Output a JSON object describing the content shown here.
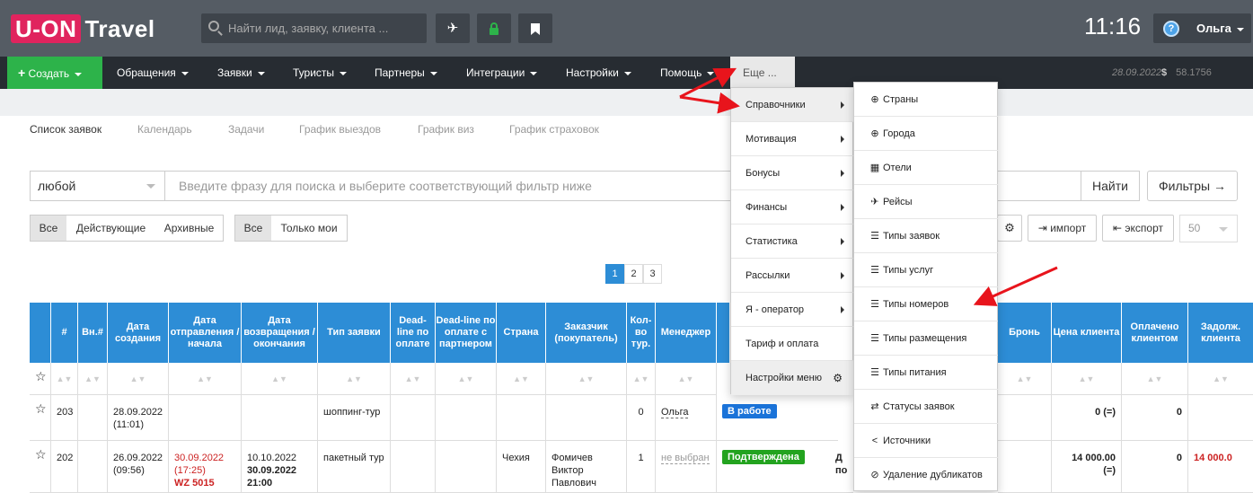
{
  "topbar": {
    "logo_box": "U-ON",
    "logo_text": "Travel",
    "search_placeholder": "Найти лид, заявку, клиента ...",
    "clock": "11:16",
    "user_name": "Ольга"
  },
  "nav": {
    "create": "Создать",
    "items": [
      "Обращения",
      "Заявки",
      "Туристы",
      "Партнеры",
      "Интеграции",
      "Настройки",
      "Помощь"
    ],
    "more": "Еще ...",
    "date": "28.09.2022",
    "currency_symbol": "$",
    "rate": "58.1756"
  },
  "tabs": [
    "Список заявок",
    "Календарь",
    "Задачи",
    "График выездов",
    "График виз",
    "График страховок"
  ],
  "search": {
    "scope": "любой",
    "placeholder": "Введите фразу для поиска и выберите соответствующий фильтр ниже",
    "find": "Найти",
    "filters": "Фильтры →"
  },
  "filters_row": {
    "group1": [
      "Все",
      "Действующие",
      "Архивные"
    ],
    "group2": [
      "Все",
      "Только мои"
    ]
  },
  "toolbar": {
    "import": "импорт",
    "export": "экспорт",
    "per_page": "50"
  },
  "pager": [
    "1",
    "2",
    "3"
  ],
  "table": {
    "headers": [
      "#",
      "Вн.#",
      "Дата создания",
      "Дата отправления / начала",
      "Дата возвращения / окончания",
      "Тип заявки",
      "Dead-line по оплате",
      "Dead-line по оплате с партнером",
      "Страна",
      "Заказчик (покупатель)",
      "Кол-во тур.",
      "Менеджер",
      "Бронь",
      "Цена клиента",
      "Оплачено клиентом",
      "Задолж. клиента"
    ],
    "rows": [
      {
        "num": "203",
        "created_date": "28.09.2022",
        "created_time": "(11:01)",
        "type": "шоппинг-тур",
        "count": "0",
        "manager": "Ольга",
        "status": "В работе",
        "status_color": "#1a73d9",
        "price": "0 (=)",
        "paid": "0"
      },
      {
        "num": "202",
        "created_date": "26.09.2022",
        "created_time": "(09:56)",
        "depart_date": "30.09.2022",
        "depart_time": "(17:25)",
        "depart_flight": "WZ 5015",
        "return_date1": "10.10.2022",
        "return_date2": "30.09.2022",
        "return_time": "21:00",
        "type": "пакетный тур",
        "country": "Чехия",
        "customer": "Фомичев Виктор Павлович",
        "count": "1",
        "manager": "не выбран",
        "status": "Подтверждена",
        "status_color": "#23a31f",
        "bron_frag1": "Д",
        "bron_frag2": "по",
        "price": "14 000.00",
        "price_sub": "(=)",
        "paid": "0",
        "debt": "14 000.0"
      }
    ]
  },
  "menu_more": {
    "items": [
      "Справочники",
      "Мотивация",
      "Бонусы",
      "Финансы",
      "Статистика",
      "Рассылки",
      "Я - оператор",
      "Тариф и оплата",
      "Настройки меню"
    ]
  },
  "menu_refs": {
    "items": [
      {
        "icon": "globe-icon",
        "glyph": "⊕",
        "label": "Страны"
      },
      {
        "icon": "globe-icon",
        "glyph": "⊕",
        "label": "Города"
      },
      {
        "icon": "building-icon",
        "glyph": "▦",
        "label": "Отели"
      },
      {
        "icon": "plane-icon",
        "glyph": "✈",
        "label": "Рейсы"
      },
      {
        "icon": "list-icon",
        "glyph": "☰",
        "label": "Типы заявок"
      },
      {
        "icon": "list-icon",
        "glyph": "☰",
        "label": "Типы услуг"
      },
      {
        "icon": "list-icon",
        "glyph": "☰",
        "label": "Типы номеров"
      },
      {
        "icon": "list-icon",
        "glyph": "☰",
        "label": "Типы размещения"
      },
      {
        "icon": "list-icon",
        "glyph": "☰",
        "label": "Типы питания"
      },
      {
        "icon": "shuffle-icon",
        "glyph": "⇄",
        "label": "Статусы заявок"
      },
      {
        "icon": "share-icon",
        "glyph": "<",
        "label": "Источники"
      },
      {
        "icon": "ban-icon",
        "glyph": "⊘",
        "label": "Удаление дубликатов"
      }
    ]
  },
  "colors": {
    "accent": "#2d8dd6",
    "create_green": "#2db34a",
    "logo_pink": "#e0245e",
    "arrow_red": "#e8141c"
  }
}
